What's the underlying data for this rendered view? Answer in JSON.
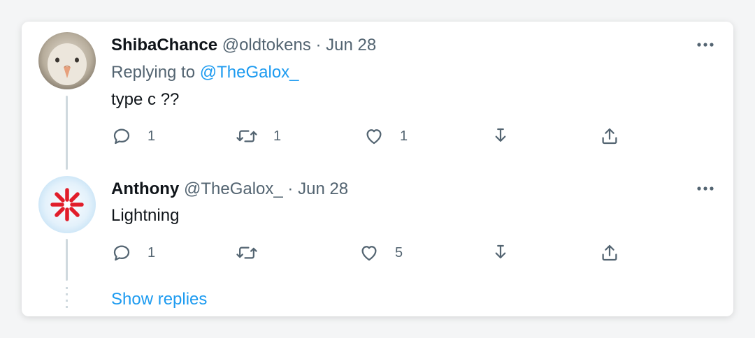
{
  "tweets": [
    {
      "name": "ShibaChance",
      "handle": "@oldtokens",
      "separator": "·",
      "date": "Jun 28",
      "replying_prefix": "Replying to",
      "replying_to": "@TheGalox_",
      "text": "type c ??",
      "counts": {
        "reply": "1",
        "retweet": "1",
        "like": "1"
      },
      "avatar_icon": "chick-avatar"
    },
    {
      "name": "Anthony",
      "handle": "@TheGalox_",
      "separator": "·",
      "date": "Jun 28",
      "text": "Lightning",
      "counts": {
        "reply": "1",
        "retweet": "",
        "like": "5"
      },
      "avatar_icon": "red-asterisk-logo-avatar"
    }
  ],
  "show_replies_label": "Show replies",
  "icons": {
    "more": "more-icon",
    "reply": "reply-icon",
    "retweet": "retweet-icon",
    "like": "like-icon",
    "save": "download-icon",
    "share": "share-icon"
  },
  "colors": {
    "accent": "#1d9bf0",
    "text": "#0f1419",
    "muted": "#536471",
    "thread_line": "#cfd9de",
    "logo_red": "#e11d2a"
  }
}
